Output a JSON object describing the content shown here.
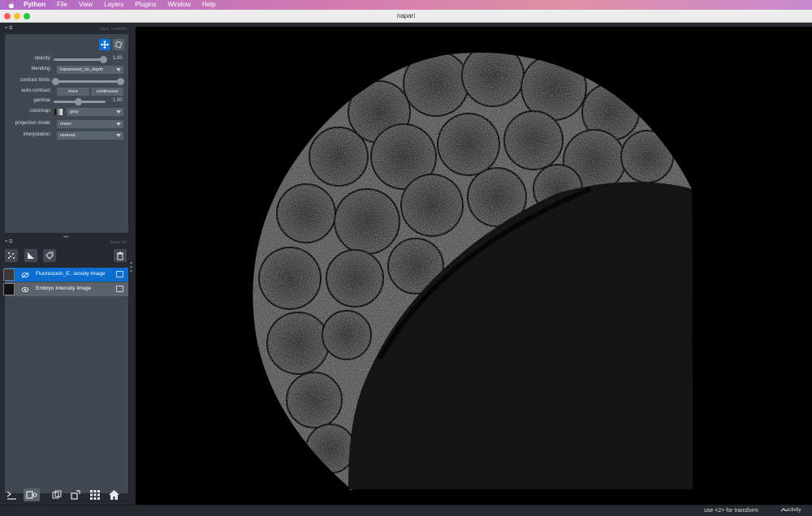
{
  "menubar": {
    "apple_icon": "apple-icon",
    "items": [
      "Python",
      "File",
      "View",
      "Layers",
      "Plugins",
      "Window",
      "Help"
    ]
  },
  "window": {
    "title": "napari"
  },
  "layer_controls": {
    "header": "layer controls",
    "opacity_label": "opacity:",
    "opacity_value": "1.00",
    "blending_label": "blending:",
    "blending_value": "translucent_no_depth",
    "contrast_label": "contrast limits:",
    "autocontrast_label": "auto-contrast:",
    "autocontrast_once": "once",
    "autocontrast_continuous": "continuous",
    "gamma_label": "gamma:",
    "gamma_value": "1.00",
    "colormap_label": "colormap:",
    "colormap_value": "gray",
    "projection_label": "projection mode:",
    "projection_value": "mean",
    "interpolation_label": "interpolation:",
    "interpolation_value": "nearest"
  },
  "layer_list": {
    "header": "layer list",
    "layers": [
      {
        "name": "Fluorescein_E...tensity Image",
        "selected": true
      },
      {
        "name": "Embryo Intensity Image",
        "selected": false
      }
    ]
  },
  "status": {
    "hint": "use <2> for transform",
    "activity": "activity"
  },
  "colors": {
    "accent": "#0a6fd1",
    "panel": "#414851",
    "background": "#262930"
  }
}
